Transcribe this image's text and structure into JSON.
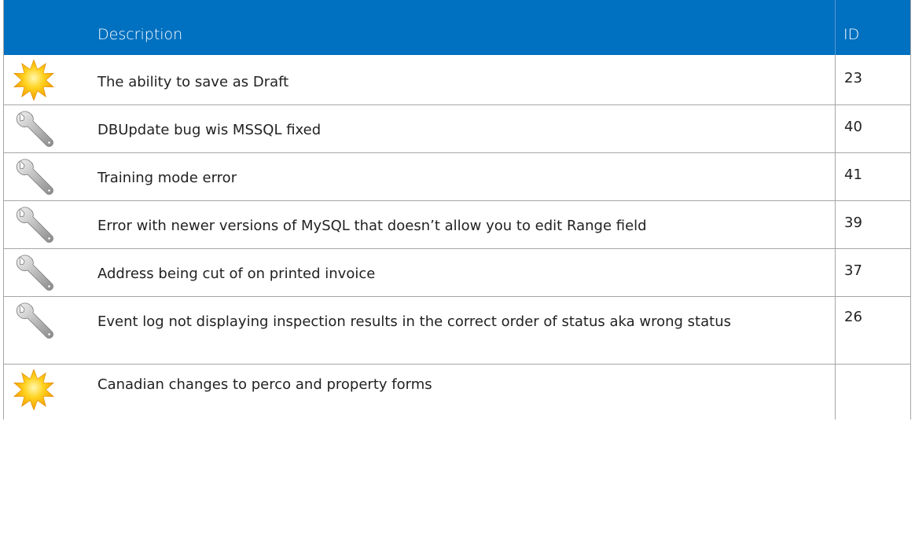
{
  "header": {
    "description_label": "Description",
    "id_label": "ID"
  },
  "rows": [
    {
      "icon": "star-icon",
      "description": "The ability to save as Draft",
      "id": "23"
    },
    {
      "icon": "wrench-icon",
      "description": "DBUpdate bug wis MSSQL fixed",
      "id": "40"
    },
    {
      "icon": "wrench-icon",
      "description": "Training mode error",
      "id": "41"
    },
    {
      "icon": "wrench-icon",
      "description": "Error with newer versions of MySQL that doesn’t allow you to edit Range field",
      "id": "39"
    },
    {
      "icon": "wrench-icon",
      "description": "Address being cut of on printed invoice",
      "id": "37"
    },
    {
      "icon": "wrench-icon",
      "description": "Event log not displaying inspection results in the correct order of status aka wrong status",
      "id": "26"
    },
    {
      "icon": "star-icon",
      "description": "Canadian changes to perco and property forms",
      "id": ""
    }
  ],
  "colors": {
    "header_bg": "#0070c0",
    "header_text": "#ffffff",
    "border": "#a6a6a6",
    "star": "#f5c518"
  }
}
